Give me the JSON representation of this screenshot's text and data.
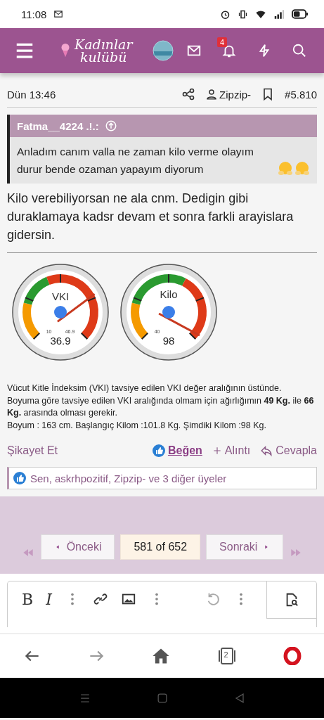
{
  "status_bar": {
    "time": "11:08"
  },
  "header": {
    "logo": {
      "line1": "Kadınlar",
      "line2": "kulübü"
    },
    "notification_count": "4"
  },
  "post": {
    "date": "Dün 13:46",
    "author": "Zipzip-",
    "number": "#5.810",
    "quote": {
      "author": "Fatma__4224 .!.:",
      "text": "Anladım canım valla ne zaman kilo verme olayım durur bende ozaman yapayım diyorum"
    },
    "text": "Kilo verebiliyorsan ne ala cnm. Dedigin gibi duraklamaya kadsr devam et sonra farkli arayislara gidersin.",
    "gauges": [
      {
        "label": "VKI",
        "min": "10",
        "max": "46.9",
        "reading": "36.9"
      },
      {
        "label": "Kilo",
        "min": "40",
        "reading": "98"
      }
    ],
    "signature": [
      "Vücut Kitle İndeksim (VKI) tavsiye edilen VKI değer aralığının üstünde.",
      "Boyuma göre tavsiye edilen VKI aralığında olmam için ağırlığımın **49 Kg.** ile **66 Kg.** arasında olması gerekir.",
      "Boyum : 163 cm. Başlangıç Kilom :101.8 Kg. Şimdiki Kilom :98 Kg."
    ],
    "report": "Şikayet Et",
    "like": "Beğen",
    "quote_action": "Alıntı",
    "reply": "Cevapla",
    "likes": "Sen, askrhpozitif, Zipzip- ve 3 diğer üyeler"
  },
  "pagination": {
    "prev": "Önceki",
    "current": "581 of 652",
    "next": "Sonraki"
  },
  "editor": {
    "bold": "B",
    "italic": "I"
  },
  "browser_nav": {
    "tab_count": "2"
  }
}
